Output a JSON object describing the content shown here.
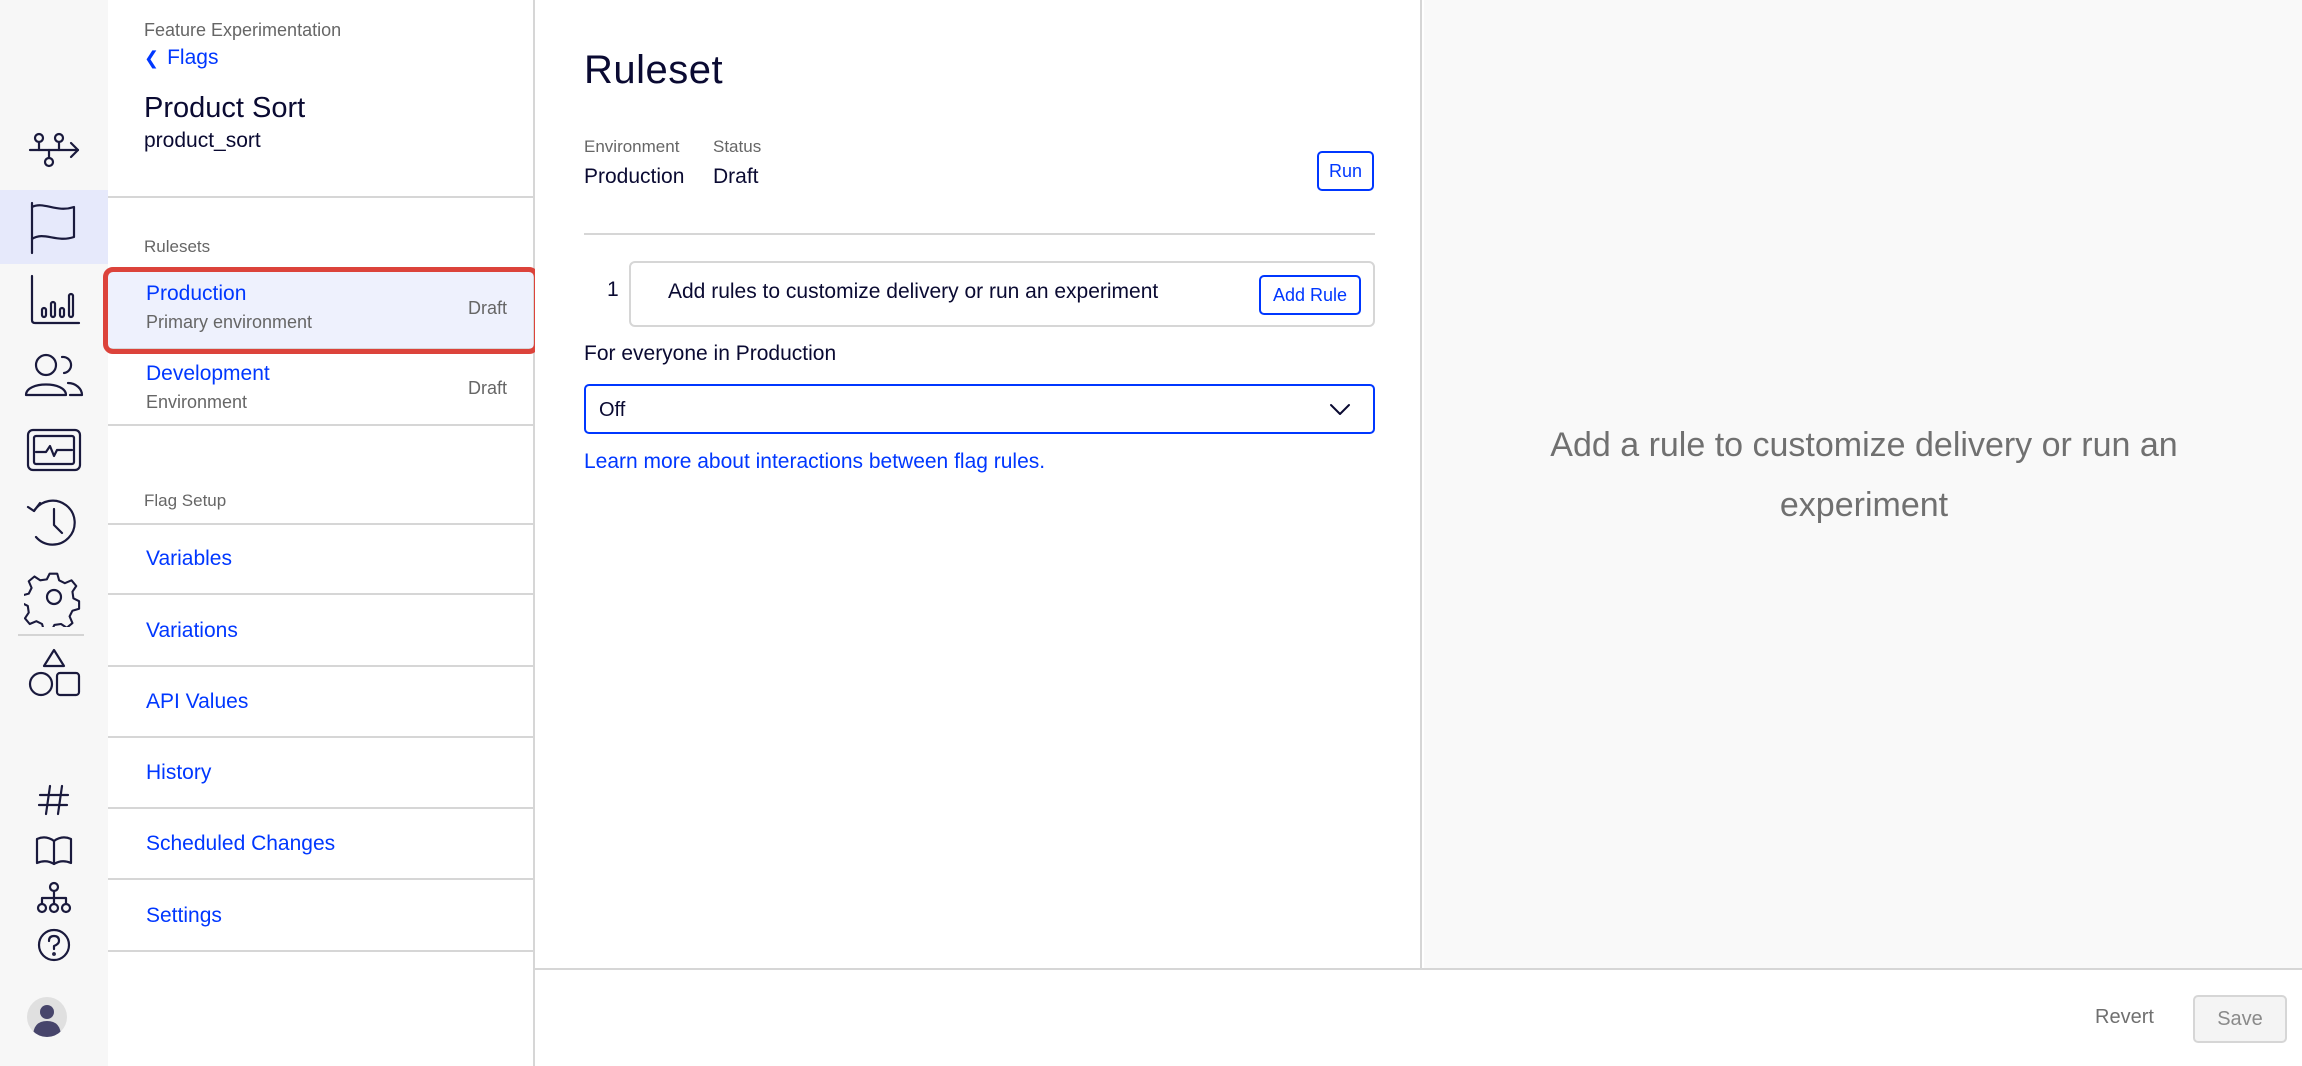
{
  "rail": {
    "items": [
      {
        "name": "experiments",
        "icon": "timeline-icon",
        "active": false
      },
      {
        "name": "flags",
        "icon": "flag-icon",
        "active": true
      },
      {
        "name": "reports",
        "icon": "bar-chart-icon",
        "active": false
      },
      {
        "name": "audiences",
        "icon": "users-icon",
        "active": false
      },
      {
        "name": "events",
        "icon": "monitor-icon",
        "active": false
      },
      {
        "name": "history",
        "icon": "history-icon",
        "active": false
      },
      {
        "name": "settings",
        "icon": "gear-icon",
        "active": false
      },
      {
        "name": "integrations",
        "icon": "shapes-icon",
        "active": false
      },
      {
        "name": "hashtag",
        "icon": "hash-icon",
        "active": false
      },
      {
        "name": "docs",
        "icon": "book-icon",
        "active": false
      },
      {
        "name": "hierarchy",
        "icon": "hierarchy-icon",
        "active": false
      },
      {
        "name": "help",
        "icon": "help-icon",
        "active": false
      },
      {
        "name": "account",
        "icon": "avatar-icon",
        "active": false
      }
    ]
  },
  "sidebar": {
    "breadcrumb": "Feature Experimentation",
    "back_label": "Flags",
    "flag_name": "Product Sort",
    "flag_key": "product_sort",
    "rulesets_heading": "Rulesets",
    "rulesets": [
      {
        "name": "Production",
        "subtitle": "Primary environment",
        "status": "Draft",
        "active": true
      },
      {
        "name": "Development",
        "subtitle": "Environment",
        "status": "Draft",
        "active": false
      }
    ],
    "setup_heading": "Flag Setup",
    "setup_items": [
      {
        "label": "Variables"
      },
      {
        "label": "Variations"
      },
      {
        "label": "API Values"
      },
      {
        "label": "History"
      },
      {
        "label": "Scheduled Changes"
      },
      {
        "label": "Settings"
      }
    ]
  },
  "main": {
    "title": "Ruleset",
    "environment_label": "Environment",
    "environment_value": "Production",
    "status_label": "Status",
    "status_value": "Draft",
    "run_label": "Run",
    "rule": {
      "number": "1",
      "text": "Add rules to customize delivery or run an experiment",
      "add_label": "Add Rule"
    },
    "everyone_label": "For everyone in Production",
    "default_select_value": "Off",
    "learn_more_link": "Learn more about interactions between flag rules."
  },
  "right_panel": {
    "empty_message": "Add a rule to customize delivery or run an experiment"
  },
  "footer": {
    "revert_label": "Revert",
    "save_label": "Save"
  },
  "colors": {
    "accent": "#0037ff",
    "highlight": "#dc433b",
    "active_bg": "#e6e9fb"
  }
}
